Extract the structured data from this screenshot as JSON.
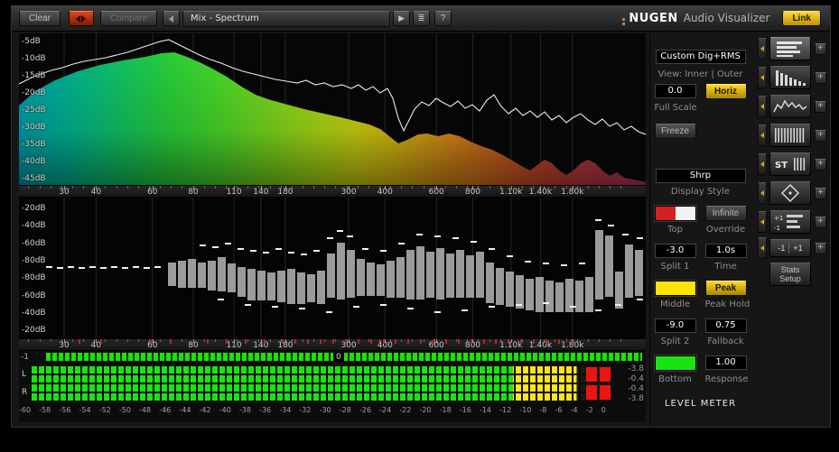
{
  "toolbar": {
    "clear": "Clear",
    "compare": "Compare",
    "preset": "Mix - Spectrum",
    "prev_glyph": "◀",
    "play_glyph": "▶",
    "menu_glyph": "≣",
    "help": "?",
    "brand_name": "NUGEN",
    "brand_suffix": "Audio Visualizer",
    "link": "Link"
  },
  "axis": {
    "freq_labels": [
      {
        "t": "30",
        "p": 7.2
      },
      {
        "t": "40",
        "p": 12.3
      },
      {
        "t": "60",
        "p": 21.3
      },
      {
        "t": "80",
        "p": 27.8
      },
      {
        "t": "110",
        "p": 34.3
      },
      {
        "t": "140",
        "p": 38.6
      },
      {
        "t": "180",
        "p": 42.5
      },
      {
        "t": "300",
        "p": 52.6
      },
      {
        "t": "400",
        "p": 58.4
      },
      {
        "t": "600",
        "p": 66.6
      },
      {
        "t": "800",
        "p": 72.4
      },
      {
        "t": "1.10k",
        "p": 78.5
      },
      {
        "t": "1.40k",
        "p": 83.2
      },
      {
        "t": "1.80k",
        "p": 88.3
      }
    ]
  },
  "spectrum": {
    "db_labels": [
      "-5dB",
      "-10dB",
      "-15dB",
      "-20dB",
      "-25dB",
      "-30dB",
      "-35dB",
      "-40dB",
      "-45dB"
    ]
  },
  "histogram": {
    "db_labels": [
      "-20dB",
      "-40dB",
      "-60dB",
      "-80dB",
      "-80dB",
      "-60dB",
      "-40dB",
      "-20dB"
    ],
    "red_ticks_pct": [
      9.5,
      13,
      21,
      24,
      30,
      33,
      36,
      39,
      42,
      44,
      46,
      48,
      50,
      52,
      54,
      56,
      58,
      60,
      62,
      64,
      66,
      68,
      70,
      72,
      74,
      76,
      78,
      80,
      82,
      84,
      86,
      88
    ]
  },
  "strip": {
    "left": "-1",
    "zero": "0"
  },
  "meter": {
    "channels": [
      "L",
      "R"
    ],
    "values": [
      "-3.8",
      "-0.4",
      "-0.4",
      "-3.8"
    ],
    "green_pct": 83,
    "yellow_pct": 94,
    "scale": [
      "-60",
      "-58",
      "-56",
      "-54",
      "-52",
      "-50",
      "-48",
      "-46",
      "-44",
      "-42",
      "-40",
      "-38",
      "-36",
      "-34",
      "-32",
      "-30",
      "-28",
      "-26",
      "-24",
      "-22",
      "-20",
      "-18",
      "-16",
      "-14",
      "-12",
      "-10",
      "-8",
      "-6",
      "-4",
      "-2",
      "0"
    ]
  },
  "controls": {
    "mode_value": "Custom Dig+RMS",
    "view_label": "View: Inner | Outer",
    "full_scale_value": "0.0",
    "horiz": "Horiz",
    "full_scale_label": "Full Scale",
    "freeze": "Freeze",
    "display_style_value": "Shrp",
    "display_style_label": "Display Style",
    "top_label": "Top",
    "override_value": "Infinite",
    "override_label": "Override",
    "split1_value": "-3.0",
    "split1_label": "Split 1",
    "time_value": "1.0s",
    "time_label": "Time",
    "middle_label": "Middle",
    "peak_hold_value": "Peak",
    "peak_hold_label": "Peak Hold",
    "split2_value": "-9.0",
    "split2_label": "Split 2",
    "fallback_value": "0.75",
    "fallback_label": "Fallback",
    "bottom_label": "Bottom",
    "response_value": "1.00",
    "response_label": "Response",
    "level_meter_label": "LEVEL METER"
  },
  "side": {
    "add": "+",
    "st": "ST",
    "mini_plus": "+1",
    "mini_minus": "-1",
    "m1": "-1",
    "p1": "+1",
    "stats_line1": "Stats",
    "stats_line2": "Setup"
  },
  "colors": {
    "accent_yellow": "#e3b40a",
    "meter_green": "#19e312",
    "meter_yellow": "#ffe41a",
    "meter_red": "#ee1212",
    "swatch_red": "#d42020",
    "swatch_white": "#f2f2f2",
    "swatch_yellow": "#ffe400",
    "swatch_green": "#1ae312",
    "spectrum_gradient": [
      [
        "0%",
        "#009aa8"
      ],
      [
        "8%",
        "#00b090"
      ],
      [
        "16%",
        "#10c060"
      ],
      [
        "24%",
        "#28cc38"
      ],
      [
        "32%",
        "#48d428"
      ],
      [
        "40%",
        "#78d41c"
      ],
      [
        "48%",
        "#a8d414"
      ],
      [
        "54%",
        "#c8cc10"
      ],
      [
        "60%",
        "#d4b410"
      ],
      [
        "66%",
        "#d49414"
      ],
      [
        "72%",
        "#d47818"
      ],
      [
        "78%",
        "#cc5c20"
      ],
      [
        "84%",
        "#c44428"
      ],
      [
        "90%",
        "#bc3840"
      ],
      [
        "96%",
        "#b43458"
      ],
      [
        "100%",
        "#b03068"
      ]
    ]
  },
  "viz": {
    "spectrum_shape": [
      [
        0,
        80
      ],
      [
        18,
        64
      ],
      [
        40,
        52
      ],
      [
        65,
        42
      ],
      [
        90,
        35
      ],
      [
        115,
        30
      ],
      [
        140,
        26
      ],
      [
        158,
        22
      ],
      [
        172,
        21
      ],
      [
        186,
        26
      ],
      [
        200,
        32
      ],
      [
        214,
        39
      ],
      [
        230,
        48
      ],
      [
        248,
        60
      ],
      [
        262,
        68
      ],
      [
        276,
        73
      ],
      [
        290,
        77
      ],
      [
        305,
        81
      ],
      [
        320,
        85
      ],
      [
        338,
        89
      ],
      [
        356,
        93
      ],
      [
        372,
        97
      ],
      [
        388,
        101
      ],
      [
        400,
        106
      ],
      [
        410,
        114
      ],
      [
        420,
        122
      ],
      [
        430,
        118
      ],
      [
        442,
        112
      ],
      [
        452,
        111
      ],
      [
        464,
        114
      ],
      [
        476,
        111
      ],
      [
        488,
        114
      ],
      [
        500,
        120
      ],
      [
        512,
        125
      ],
      [
        524,
        129
      ],
      [
        536,
        135
      ],
      [
        548,
        142
      ],
      [
        558,
        148
      ],
      [
        566,
        152
      ],
      [
        574,
        146
      ],
      [
        582,
        140
      ],
      [
        590,
        144
      ],
      [
        598,
        152
      ],
      [
        606,
        157
      ],
      [
        614,
        152
      ],
      [
        622,
        144
      ],
      [
        630,
        140
      ],
      [
        638,
        144
      ],
      [
        646,
        152
      ],
      [
        654,
        158
      ],
      [
        662,
        154
      ],
      [
        670,
        160
      ],
      [
        680,
        162
      ],
      [
        694,
        165
      ]
    ],
    "peak_line": [
      [
        0,
        56
      ],
      [
        12,
        50
      ],
      [
        24,
        45
      ],
      [
        36,
        41
      ],
      [
        48,
        38
      ],
      [
        60,
        34
      ],
      [
        72,
        31
      ],
      [
        84,
        29
      ],
      [
        96,
        27
      ],
      [
        108,
        24
      ],
      [
        120,
        21
      ],
      [
        132,
        17
      ],
      [
        144,
        13
      ],
      [
        156,
        9
      ],
      [
        166,
        7
      ],
      [
        176,
        12
      ],
      [
        188,
        18
      ],
      [
        200,
        24
      ],
      [
        212,
        29
      ],
      [
        224,
        33
      ],
      [
        236,
        38
      ],
      [
        248,
        42
      ],
      [
        260,
        45
      ],
      [
        272,
        48
      ],
      [
        284,
        51
      ],
      [
        296,
        53
      ],
      [
        308,
        55
      ],
      [
        318,
        52
      ],
      [
        328,
        57
      ],
      [
        338,
        55
      ],
      [
        348,
        59
      ],
      [
        358,
        57
      ],
      [
        368,
        61
      ],
      [
        376,
        57
      ],
      [
        384,
        63
      ],
      [
        392,
        59
      ],
      [
        400,
        66
      ],
      [
        408,
        61
      ],
      [
        414,
        72
      ],
      [
        420,
        94
      ],
      [
        426,
        108
      ],
      [
        432,
        96
      ],
      [
        438,
        84
      ],
      [
        446,
        76
      ],
      [
        454,
        80
      ],
      [
        462,
        72
      ],
      [
        470,
        77
      ],
      [
        478,
        81
      ],
      [
        486,
        75
      ],
      [
        494,
        83
      ],
      [
        502,
        79
      ],
      [
        510,
        86
      ],
      [
        518,
        74
      ],
      [
        526,
        68
      ],
      [
        534,
        81
      ],
      [
        542,
        89
      ],
      [
        550,
        83
      ],
      [
        558,
        91
      ],
      [
        566,
        86
      ],
      [
        574,
        93
      ],
      [
        582,
        87
      ],
      [
        590,
        96
      ],
      [
        598,
        91
      ],
      [
        606,
        99
      ],
      [
        614,
        93
      ],
      [
        622,
        89
      ],
      [
        630,
        96
      ],
      [
        638,
        101
      ],
      [
        646,
        95
      ],
      [
        654,
        103
      ],
      [
        662,
        99
      ],
      [
        670,
        107
      ],
      [
        678,
        103
      ],
      [
        686,
        109
      ],
      [
        694,
        112
      ]
    ],
    "hist_bars": [
      [
        165,
        72,
        26
      ],
      [
        176,
        70,
        30
      ],
      [
        187,
        68,
        32
      ],
      [
        198,
        72,
        28
      ],
      [
        209,
        70,
        33
      ],
      [
        220,
        66,
        38
      ],
      [
        231,
        73,
        32
      ],
      [
        242,
        77,
        33
      ],
      [
        253,
        79,
        35
      ],
      [
        264,
        81,
        33
      ],
      [
        275,
        83,
        31
      ],
      [
        286,
        81,
        35
      ],
      [
        297,
        79,
        39
      ],
      [
        308,
        83,
        35
      ],
      [
        319,
        85,
        31
      ],
      [
        330,
        81,
        37
      ],
      [
        341,
        62,
        49
      ],
      [
        352,
        50,
        63
      ],
      [
        363,
        58,
        53
      ],
      [
        374,
        68,
        41
      ],
      [
        385,
        72,
        37
      ],
      [
        396,
        74,
        35
      ],
      [
        407,
        70,
        41
      ],
      [
        418,
        66,
        45
      ],
      [
        429,
        58,
        55
      ],
      [
        440,
        54,
        59
      ],
      [
        451,
        60,
        51
      ],
      [
        462,
        56,
        57
      ],
      [
        473,
        62,
        49
      ],
      [
        484,
        58,
        53
      ],
      [
        495,
        64,
        47
      ],
      [
        506,
        60,
        51
      ],
      [
        517,
        72,
        45
      ],
      [
        528,
        78,
        41
      ],
      [
        539,
        82,
        39
      ],
      [
        550,
        86,
        37
      ],
      [
        561,
        90,
        35
      ],
      [
        572,
        88,
        39
      ],
      [
        583,
        92,
        35
      ],
      [
        594,
        94,
        33
      ],
      [
        605,
        90,
        37
      ],
      [
        616,
        92,
        35
      ],
      [
        627,
        88,
        39
      ],
      [
        638,
        36,
        77
      ],
      [
        649,
        42,
        68
      ],
      [
        660,
        82,
        41
      ],
      [
        671,
        52,
        59
      ],
      [
        682,
        58,
        51
      ]
    ],
    "hist_dashes": [
      [
        30,
        76
      ],
      [
        42,
        77
      ],
      [
        54,
        76
      ],
      [
        66,
        77
      ],
      [
        78,
        76
      ],
      [
        90,
        77
      ],
      [
        102,
        76
      ],
      [
        114,
        77
      ],
      [
        126,
        76
      ],
      [
        138,
        77
      ],
      [
        150,
        76
      ],
      [
        200,
        52
      ],
      [
        214,
        54
      ],
      [
        228,
        50
      ],
      [
        242,
        56
      ],
      [
        256,
        58
      ],
      [
        270,
        60
      ],
      [
        284,
        56
      ],
      [
        298,
        60
      ],
      [
        312,
        62
      ],
      [
        326,
        58
      ],
      [
        341,
        44
      ],
      [
        352,
        36
      ],
      [
        363,
        42
      ],
      [
        380,
        56
      ],
      [
        400,
        58
      ],
      [
        420,
        50
      ],
      [
        440,
        40
      ],
      [
        460,
        42
      ],
      [
        480,
        44
      ],
      [
        500,
        48
      ],
      [
        520,
        56
      ],
      [
        540,
        64
      ],
      [
        560,
        70
      ],
      [
        580,
        72
      ],
      [
        600,
        74
      ],
      [
        620,
        72
      ],
      [
        638,
        24
      ],
      [
        652,
        30
      ],
      [
        668,
        40
      ],
      [
        684,
        44
      ],
      [
        220,
        112
      ],
      [
        250,
        118
      ],
      [
        280,
        120
      ],
      [
        310,
        122
      ],
      [
        340,
        126
      ],
      [
        370,
        120
      ],
      [
        400,
        118
      ],
      [
        430,
        122
      ],
      [
        460,
        126
      ],
      [
        490,
        124
      ],
      [
        520,
        120
      ],
      [
        550,
        118
      ],
      [
        580,
        116
      ],
      [
        610,
        120
      ],
      [
        638,
        124
      ],
      [
        660,
        118
      ],
      [
        684,
        112
      ]
    ]
  }
}
